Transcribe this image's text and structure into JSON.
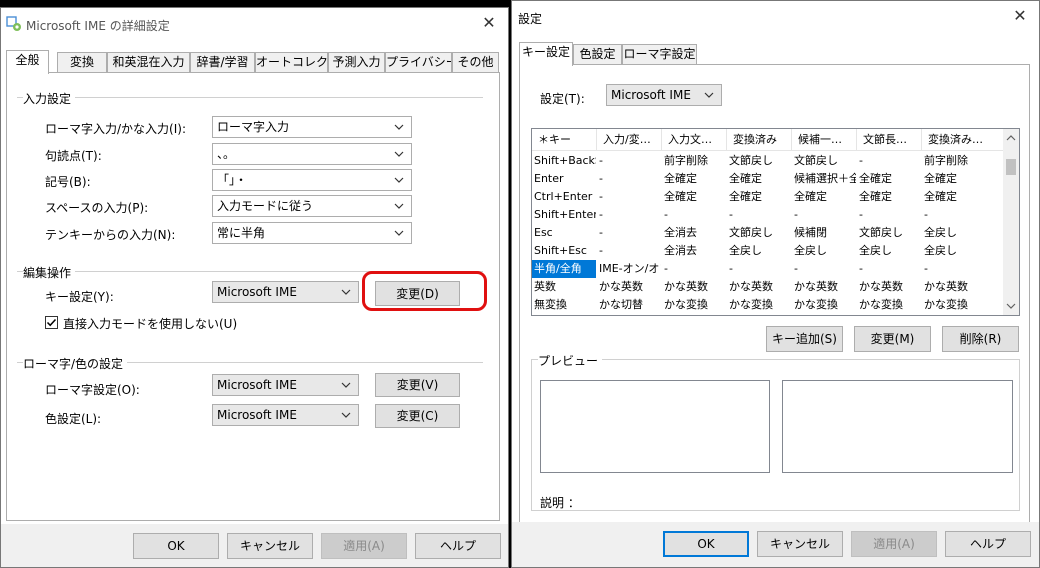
{
  "left_dialog": {
    "title": "Microsoft IME の詳細設定",
    "tabs": [
      "全般",
      "変換",
      "和英混在入力",
      "辞書/学習",
      "オートコレクト",
      "予測入力",
      "プライバシー",
      "その他"
    ],
    "input_section": {
      "header": "入力設定",
      "rows": [
        {
          "label": "ローマ字入力/かな入力(I):",
          "value": "ローマ字入力"
        },
        {
          "label": "句読点(T):",
          "value": "、。"
        },
        {
          "label": "記号(B):",
          "value": "「」・"
        },
        {
          "label": "スペースの入力(P):",
          "value": "入力モードに従う"
        },
        {
          "label": "テンキーからの入力(N):",
          "value": "常に半角"
        }
      ]
    },
    "edit_section": {
      "header": "編集操作",
      "key_label": "キー設定(Y):",
      "key_value": "Microsoft IME",
      "change_button": "変更(D)",
      "checkbox_label": "直接入力モードを使用しない(U)"
    },
    "roman_section": {
      "header": "ローマ字/色の設定",
      "roman_label": "ローマ字設定(O):",
      "roman_value": "Microsoft IME",
      "roman_button": "変更(V)",
      "color_label": "色設定(L):",
      "color_value": "Microsoft IME",
      "color_button": "変更(C)"
    },
    "footer": {
      "ok": "OK",
      "cancel": "キャンセル",
      "apply": "適用(A)",
      "help": "ヘルプ"
    }
  },
  "right_dialog": {
    "title": "設定",
    "tabs": [
      "キー設定",
      "色設定",
      "ローマ字設定"
    ],
    "setting_label": "設定(T):",
    "setting_value": "Microsoft IME",
    "columns": [
      "＊キー",
      "入力/変…",
      "入力文…",
      "変換済み",
      "候補一…",
      "文節長…",
      "変換済み…"
    ],
    "rows": [
      [
        "Shift+BackS",
        "-",
        "前字削除",
        "文節戻し",
        "文節戻し",
        "-",
        "前字削除"
      ],
      [
        "Enter",
        "-",
        "全確定",
        "全確定",
        "候補選択＋全",
        "全確定",
        "全確定"
      ],
      [
        "Ctrl+Enter",
        "-",
        "全確定",
        "全確定",
        "全確定",
        "全確定",
        "全確定"
      ],
      [
        "Shift+Enter",
        "-",
        "-",
        "-",
        "-",
        "-",
        "-"
      ],
      [
        "Esc",
        "-",
        "全消去",
        "文節戻し",
        "候補閉",
        "文節戻し",
        "全戻し"
      ],
      [
        "Shift+Esc",
        "-",
        "全消去",
        "全戻し",
        "全戻し",
        "全戻し",
        "全戻し"
      ],
      [
        "半角/全角",
        "IME-オン/オフ",
        "-",
        "-",
        "-",
        "-",
        "-"
      ],
      [
        "英数",
        "かな英数",
        "かな英数",
        "かな英数",
        "かな英数",
        "かな英数",
        "かな英数"
      ],
      [
        "無変換",
        "かな切替",
        "かな変換",
        "かな変換",
        "かな変換",
        "かな変換",
        "かな変換"
      ]
    ],
    "selected_key": "半角/全角",
    "buttons": {
      "add": "キー追加(S)",
      "change": "変更(M)",
      "delete": "削除(R)"
    },
    "preview_header": "プレビュー",
    "description_label": "説明 ：",
    "footer": {
      "ok": "OK",
      "cancel": "キャンセル",
      "apply": "適用(A)",
      "help": "ヘルプ"
    }
  },
  "accent_color": "#0078d7",
  "highlight_color": "#e01010"
}
